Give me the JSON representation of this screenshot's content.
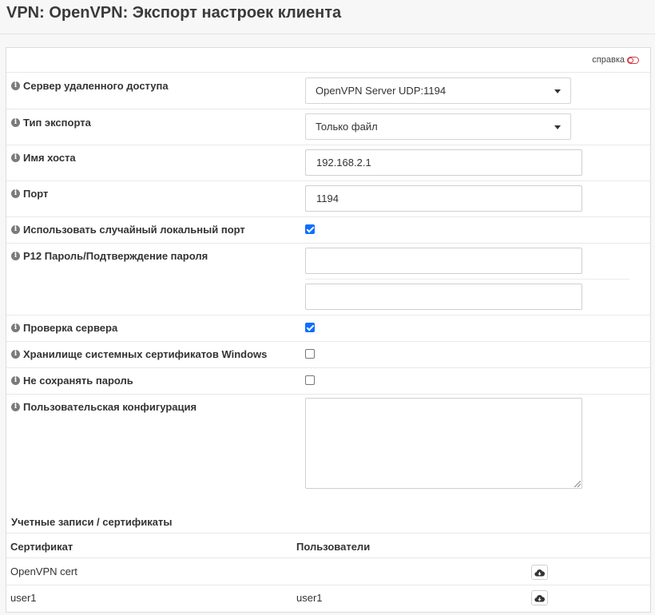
{
  "page": {
    "title": "VPN: OpenVPN: Экспорт настроек клиента"
  },
  "help": {
    "label": "справка"
  },
  "form": {
    "remote_server": {
      "label": "Сервер удаленного доступа",
      "value": "OpenVPN Server UDP:1194"
    },
    "export_type": {
      "label": "Тип экспорта",
      "value": "Только файл"
    },
    "hostname": {
      "label": "Имя хоста",
      "value": "192.168.2.1"
    },
    "port": {
      "label": "Порт",
      "value": "1194"
    },
    "random_local_port": {
      "label": "Использовать случайный локальный порт",
      "checked": true
    },
    "p12_password": {
      "label": "P12 Пароль/Подтверждение пароля",
      "value": "",
      "confirm_value": ""
    },
    "verify_server": {
      "label": "Проверка сервера",
      "checked": true
    },
    "windows_cert_store": {
      "label": "Хранилище системных сертификатов Windows",
      "checked": false
    },
    "dont_save_password": {
      "label": "Не сохранять пароль",
      "checked": false
    },
    "custom_config": {
      "label": "Пользовательская конфигурация",
      "value": ""
    }
  },
  "accounts": {
    "title": "Учетные записи / сертификаты",
    "columns": [
      "Сертификат",
      "Пользователи"
    ],
    "rows": [
      {
        "certificate": "OpenVPN cert",
        "users": ""
      },
      {
        "certificate": "user1",
        "users": "user1"
      }
    ]
  },
  "icons": {
    "info": "info-icon",
    "download": "cloud-download-icon",
    "dropdown": "chevron-down-icon"
  },
  "colors": {
    "checkbox_checked": "#0d6efd",
    "help_toggle": "#d9363e"
  }
}
